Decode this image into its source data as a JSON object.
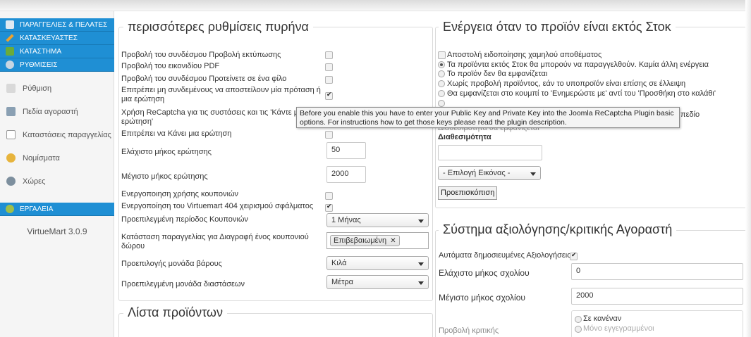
{
  "sidebar": {
    "items": [
      {
        "label": "ΠΑΡΑΓΓΕΛΙΕΣ & ΠΕΛΑΤΕΣ"
      },
      {
        "label": "ΚΑΤΑΣΚΕΥΑΣΤΕΣ"
      },
      {
        "label": "ΚΑΤΑΣΤΗΜΑ"
      },
      {
        "label": "ΡΥΘΜΙΣΕΙΣ"
      }
    ],
    "sub_items": [
      {
        "label": "Ρύθμιση"
      },
      {
        "label": "Πεδία αγοραστή"
      },
      {
        "label": "Καταστάσεις παραγγελίας"
      },
      {
        "label": "Νομίσματα"
      },
      {
        "label": "Χώρες"
      }
    ],
    "tools": "ΕΡΓΑΛΕΙΑ",
    "version": "VirtueMart 3.0.9"
  },
  "core": {
    "title": "περισσότερες ρυθμίσεις πυρήνα",
    "rows": {
      "print_link": "Προβολή του συνδέσμου Προβολή εκτύπωσης",
      "pdf_icon": "Προβολή του εικονιδίου PDF",
      "recommend_link": "Προβολή του συνδέσμου Προτείνετε σε ένα φίλο",
      "allow_unregistered_line1": "Επιτρέπει μη συνδεμένους να αποστείλουν μία πρόταση ή",
      "allow_unregistered_line2": "μια ερώτηση",
      "recaptcha_line1": "Χρήση ReCaptcha για τις συστάσεις και τις 'Κάντε μ",
      "recaptcha_line2": "ερώτηση'",
      "allow_question": "Επιτρέπει να Κάνει μια ερώτηση",
      "min_question_len": "Ελάχιστο μήκος ερώτησης",
      "min_question_val": "50",
      "max_question_len": "Μέγιστο μήκος ερώτησης",
      "max_question_val": "2000",
      "coupons_enable": "Ενεργοποιηση χρήσης κουπονιών",
      "vm404": "Ενεργοποίηση του Virtuemart 404 χειρισμού σφάλματος",
      "coupon_period": "Προεπιλεγμένη περίοδος Κουπονιών",
      "coupon_period_val": "1 Μήνας",
      "coupon_status_line1": "Κατάσταση παραγγελίας για Διαγραφή ένος κουπονιού",
      "coupon_status_line2": "δώρου",
      "coupon_status_tag": "Επιβεβαιωμένη",
      "weight_unit": "Προεπιλογής μονάδα βάρους",
      "weight_unit_val": "Κιλά",
      "dim_unit": "Προεπιλεγμένη μονάδα διαστάσεων",
      "dim_unit_val": "Μέτρα"
    }
  },
  "product_list": {
    "title": "Λίστα προϊόντων"
  },
  "stock": {
    "title": "Ενέργεια όταν το προϊόν είναι εκτός Στοκ",
    "low_stock": "Αποστολή ειδοποίησης χαμηλού αποθέματος",
    "opt1": "Τα προϊόντα εκτός Στοκ θα μπορούν να παραγγελθούν. Καμία άλλη ενέργεια",
    "opt2": "Το προϊόν δεν θα εμφανίζεται",
    "opt3": "Χωρίς προβολή προϊόντος, εάν το υποπροϊόν είναι επίσης σε έλλειψη",
    "opt4": "Θα εμφανίζεται στο κουμπί το 'Ενημερώστε με' αντί του 'Προσθήκη στο καλάθι'",
    "partial_tail": "πεδίο",
    "partial_hidden": "Διαθεσιμότητα θα εμφανίζεται",
    "availability": "Διαθεσιμότητα",
    "image_select": "- Επιλογή Εικόνας -",
    "preview_button": "Προεπισκόπιση"
  },
  "reviews": {
    "title": "Σύστημα αξιολόγησης/κριτικής Αγοραστή",
    "auto_publish": "Αυτόματα δημοσιευμένες Αξιολογήσεις",
    "min_comment": "Ελάχιστο μήκος σχολίου",
    "min_comment_val": "0",
    "max_comment": "Μέγιστο μήκος σχολίου",
    "max_comment_val": "2000",
    "show_review": "Προβολή κριτικής",
    "opt_none": "Σε κανέναν",
    "opt_registered": "Μόνο εγγεγραμμένοι"
  },
  "tooltip": {
    "text": "Before you enable this you have to enter your Public Key and Private Key into the Joomla ReCaptcha Plugin basic options. For instructions how to get those keys please read the plugin description."
  },
  "colors": {
    "sidebar_blue": "#1f8fd4",
    "icon_orange": "#f0a22b",
    "icon_green": "#6aab3a"
  }
}
